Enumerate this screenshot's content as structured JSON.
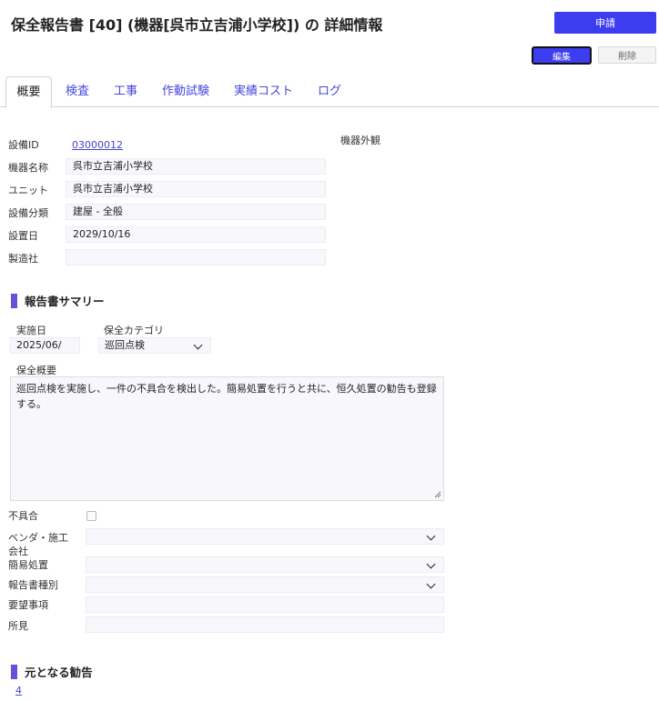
{
  "header": {
    "title": "保全報告書 [40] (機器[呉市立吉浦小学校]) の 詳細情報",
    "apply_label": "申請",
    "edit_label": "編集",
    "delete_label": "削除"
  },
  "tabs": [
    {
      "label": "概要",
      "active": true
    },
    {
      "label": "検査",
      "active": false
    },
    {
      "label": "工事",
      "active": false
    },
    {
      "label": "作動試験",
      "active": false
    },
    {
      "label": "実績コスト",
      "active": false
    },
    {
      "label": "ログ",
      "active": false
    }
  ],
  "equipment": {
    "id_label": "設備ID",
    "id_value": "03000012",
    "name_label": "機器名称",
    "name_value": "呉市立吉浦小学校",
    "unit_label": "ユニット",
    "unit_value": "呉市立吉浦小学校",
    "category_label": "設備分類",
    "category_value": "建屋 - 全般",
    "install_label": "設置日",
    "install_value": "2029/10/16",
    "maker_label": "製造社",
    "maker_value": "",
    "appearance_label": "機器外観"
  },
  "summary": {
    "heading": "報告書サマリー",
    "date_label": "実施日",
    "date_value": "2025/06/",
    "category_label": "保全カテゴリ",
    "category_value": "巡回点検",
    "overview_label": "保全概要",
    "overview_value": "巡回点検を実施し、一件の不具合を検出した。簡易処置を行うと共に、恒久処置の勧告も登録する。",
    "defect_label": "不具合",
    "defect_checked": false,
    "vendor_label_line1": "ベンダ・施工",
    "vendor_label_line2": "会社",
    "vendor_value": "",
    "simple_label": "簡易処置",
    "simple_value": "",
    "report_type_label": "報告書種別",
    "report_type_value": "",
    "request_label": "要望事項",
    "request_value": "",
    "findings_label": "所見",
    "findings_value": ""
  },
  "source": {
    "heading": "元となる勧告",
    "link": "4"
  },
  "colors": {
    "accent": "#3d3df0",
    "section_bar": "#6b4fd8",
    "link": "#4545c8"
  }
}
